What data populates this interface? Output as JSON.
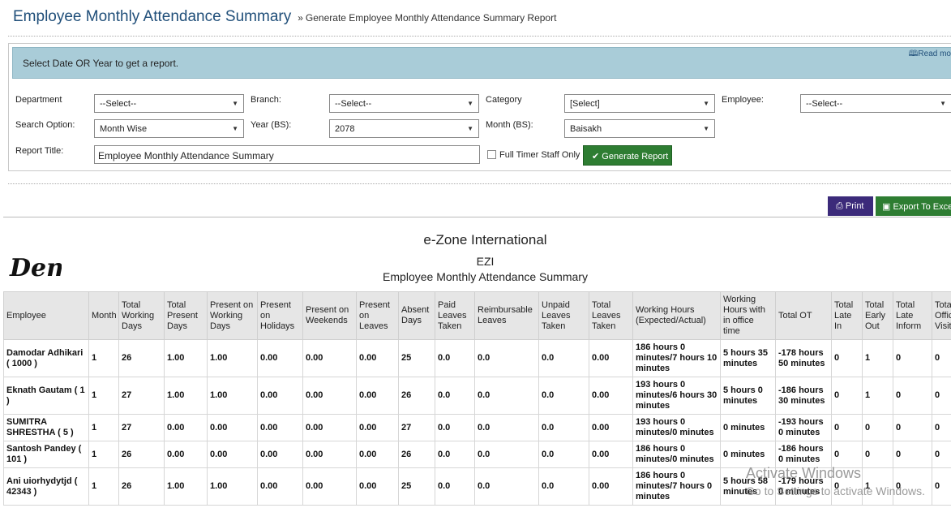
{
  "header": {
    "title": "Employee Monthly Attendance Summary",
    "breadcrumb_sep": "»",
    "breadcrumb": "Generate Employee Monthly Attendance Summary Report"
  },
  "info": {
    "message": "Select Date OR Year to get a report.",
    "read_more": "Read mo"
  },
  "filters": {
    "department": {
      "label": "Department",
      "value": "--Select--"
    },
    "branch": {
      "label": "Branch:",
      "value": "--Select--"
    },
    "category": {
      "label": "Category",
      "value": "[Select]"
    },
    "employee": {
      "label": "Employee:",
      "value": "--Select--"
    },
    "search_option": {
      "label": "Search Option:",
      "value": "Month Wise"
    },
    "year": {
      "label": "Year (BS):",
      "value": "2078"
    },
    "month": {
      "label": "Month (BS):",
      "value": "Baisakh"
    },
    "report_title": {
      "label": "Report Title:",
      "value": "Employee Monthly Attendance Summary"
    },
    "full_timer": {
      "label": "Full Timer Staff Only",
      "checked": false
    },
    "generate_label": "Generate Report"
  },
  "actions": {
    "print_label": "Print",
    "export_label": "Export To Excel"
  },
  "report": {
    "logo_text": "Demo",
    "company_name": "e-Zone International",
    "company_code": "EZI",
    "title": "Employee Monthly Attendance Summary",
    "columns": [
      "Employee",
      "Month",
      "Total Working Days",
      "Total Present Days",
      "Present on Working Days",
      "Present on Holidays",
      "Present on Weekends",
      "Present on Leaves",
      "Absent Days",
      "Paid Leaves Taken",
      "Reimbursable Leaves",
      "Unpaid Leaves Taken",
      "Total Leaves Taken",
      "Working Hours (Expected/Actual)",
      "Working Hours with in office time",
      "Total OT",
      "Total Late In",
      "Total Early Out",
      "Total Late Inform",
      "Total Official Visit"
    ],
    "rows": [
      [
        "Damodar Adhikari ( 1000 )",
        "1",
        "26",
        "1.00",
        "1.00",
        "0.00",
        "0.00",
        "0.00",
        "25",
        "0.0",
        "0.0",
        "0.0",
        "0.00",
        "186 hours 0 minutes/7 hours 10 minutes",
        "5 hours 35 minutes",
        "-178 hours 50 minutes",
        "0",
        "1",
        "0",
        "0"
      ],
      [
        "Eknath Gautam ( 1 )",
        "1",
        "27",
        "1.00",
        "1.00",
        "0.00",
        "0.00",
        "0.00",
        "26",
        "0.0",
        "0.0",
        "0.0",
        "0.00",
        "193 hours 0 minutes/6 hours 30 minutes",
        "5 hours 0 minutes",
        "-186 hours 30 minutes",
        "0",
        "1",
        "0",
        "0"
      ],
      [
        "SUMITRA SHRESTHA ( 5 )",
        "1",
        "27",
        "0.00",
        "0.00",
        "0.00",
        "0.00",
        "0.00",
        "27",
        "0.0",
        "0.0",
        "0.0",
        "0.00",
        "193 hours 0 minutes/0 minutes",
        "0 minutes",
        "-193 hours 0 minutes",
        "0",
        "0",
        "0",
        "0"
      ],
      [
        "Santosh Pandey ( 101 )",
        "1",
        "26",
        "0.00",
        "0.00",
        "0.00",
        "0.00",
        "0.00",
        "26",
        "0.0",
        "0.0",
        "0.0",
        "0.00",
        "186 hours 0 minutes/0 minutes",
        "0 minutes",
        "-186 hours 0 minutes",
        "0",
        "0",
        "0",
        "0"
      ],
      [
        "Ani uiorhydytjd ( 42343 )",
        "1",
        "26",
        "1.00",
        "1.00",
        "0.00",
        "0.00",
        "0.00",
        "25",
        "0.0",
        "0.0",
        "0.0",
        "0.00",
        "186 hours 0 minutes/7 hours 0 minutes",
        "5 hours 58 minutes",
        "-179 hours 0 minutes",
        "0",
        "1",
        "0",
        "0"
      ]
    ]
  },
  "watermark": {
    "line1": "Activate Windows",
    "line2": "Go to Settings to activate Windows."
  }
}
